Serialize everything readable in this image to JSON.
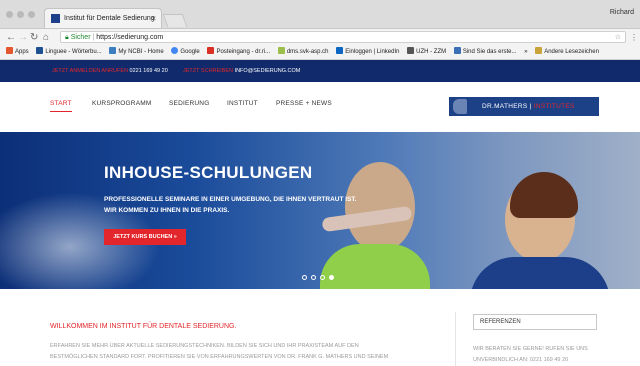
{
  "browser": {
    "tab_title": "Institut für Dentale Sedierung",
    "tab_close": "×",
    "user_name": "Richard",
    "secure_label": "Sicher",
    "url": "https://sedierung.com",
    "nav_icons": [
      "back-icon",
      "forward-icon",
      "reload-icon",
      "home-icon"
    ]
  },
  "bookmarks": [
    "Apps",
    "Linguee - Wörterbu...",
    "My NCBI - Home",
    "Google",
    "Posteingang - dr.ri...",
    "dms.svk-asp.ch",
    "Einloggen | LinkedIn",
    "UZH - ZZM",
    "Sind Sie das erste...",
    "»",
    "Andere Lesezeichen"
  ],
  "topbar": {
    "phone_label": "JETZT ANMELDEN ANRUFEN",
    "phone": "0221 169 49 20",
    "email_label": "JETZT SCHREIBEN",
    "email": "INFO@SEDIERUNG.COM"
  },
  "nav": {
    "items": [
      "START",
      "KURSPROGRAMM",
      "SEDIERUNG",
      "INSTITUT",
      "PRESSE + NEWS"
    ]
  },
  "logo": {
    "name": "DR.MATHERS",
    "sep": "|",
    "suffix": "INSTITUTES"
  },
  "hero": {
    "title": "INHOUSE-SCHULUNGEN",
    "subtitle_1": "PROFESSIONELLE SEMINARE IN EINER UMGEBUNG, DIE IHNEN VERTRAUT IST.",
    "subtitle_2": "WIR KOMMEN ZU IHNEN IN DIE PRAXIS.",
    "button": "JETZT KURS BUCHEN »"
  },
  "content": {
    "welcome": "WILLKOMMEN IM INSTITUT FÜR DENTALE SEDIERUNG.",
    "para_1": "ERFAHREN SIE MEHR ÜBER AKTUELLE SEDIERUNGSTECHNIKEN. BILDEN SIE SICH UND IHR PRAXISTEAM AUF DEN",
    "para_2": "BESTMÖGLICHEN STANDARD FORT. PROFITIEREN SIE VON ERFAHRUNGSWERTEN VON DR. FRANK G. MATHERS UND SEINEM",
    "ref_label": "REFERENZEN",
    "side_1": "WIR BERATEN SIE GERNE! RUFEN SIE UNS",
    "side_2": "UNVERBINDLICH AN: 0221 169 49 20"
  },
  "colors": {
    "brand_blue": "#102a6b",
    "accent_red": "#e3262b"
  }
}
